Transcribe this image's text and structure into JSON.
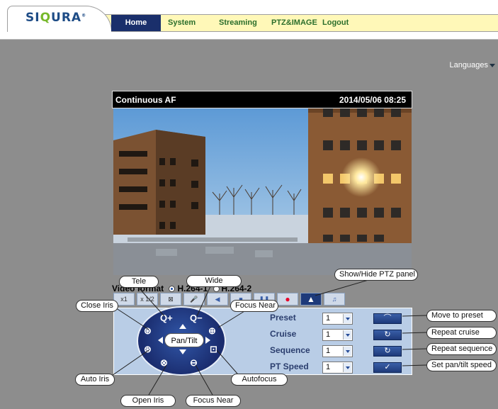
{
  "brand": {
    "logo_prefix": "SI",
    "logo_q": "Q",
    "logo_suffix": "URA",
    "logo_mark": "®"
  },
  "nav": {
    "home": "Home",
    "system": "System",
    "streaming": "Streaming",
    "ptz_image": "PTZ&IMAGE",
    "logout": "Logout"
  },
  "languages": "Languages",
  "video": {
    "title": "Continuous AF",
    "timestamp": "2014/05/06 08:25"
  },
  "video_format": {
    "label": "Video format",
    "options": [
      "H.264-1",
      "H.264-2"
    ],
    "selected": "H.264-1"
  },
  "toolbar": {
    "zoom_1x": "x1",
    "zoom_half": "x 1/2"
  },
  "ptz": {
    "center_button": "Pan/Tilt",
    "rows": [
      {
        "label": "Preset",
        "value": "1",
        "action_icon": "goto-arc-icon"
      },
      {
        "label": "Cruise",
        "value": "1",
        "action_icon": "repeat-icon"
      },
      {
        "label": "Sequence",
        "value": "1",
        "action_icon": "repeat-icon"
      },
      {
        "label": "PT Speed",
        "value": "1",
        "action_icon": "checkmark-icon"
      }
    ]
  },
  "callouts": {
    "tele": "Tele",
    "wide": "Wide",
    "show_hide": "Show/Hide PTZ panel",
    "close_iris": "Close Iris",
    "focus_near_top": "Focus Near",
    "move_to_preset": "Move to preset",
    "repeat_cruise": "Repeat cruise",
    "repeat_sequence": "Repeat sequence",
    "set_speed": "Set pan/tilt speed",
    "auto_iris": "Auto Iris",
    "autofocus": "Autofocus",
    "open_iris": "Open Iris",
    "focus_near_bottom": "Focus Near"
  },
  "colors": {
    "nav_active": "#1a2f6b",
    "nav_bar": "#fff8b8",
    "page_bg": "#8d8d8d",
    "ptz_panel": "#b9cde6",
    "ptz_circle": "#1a2c6e",
    "record": "#e8002a"
  }
}
